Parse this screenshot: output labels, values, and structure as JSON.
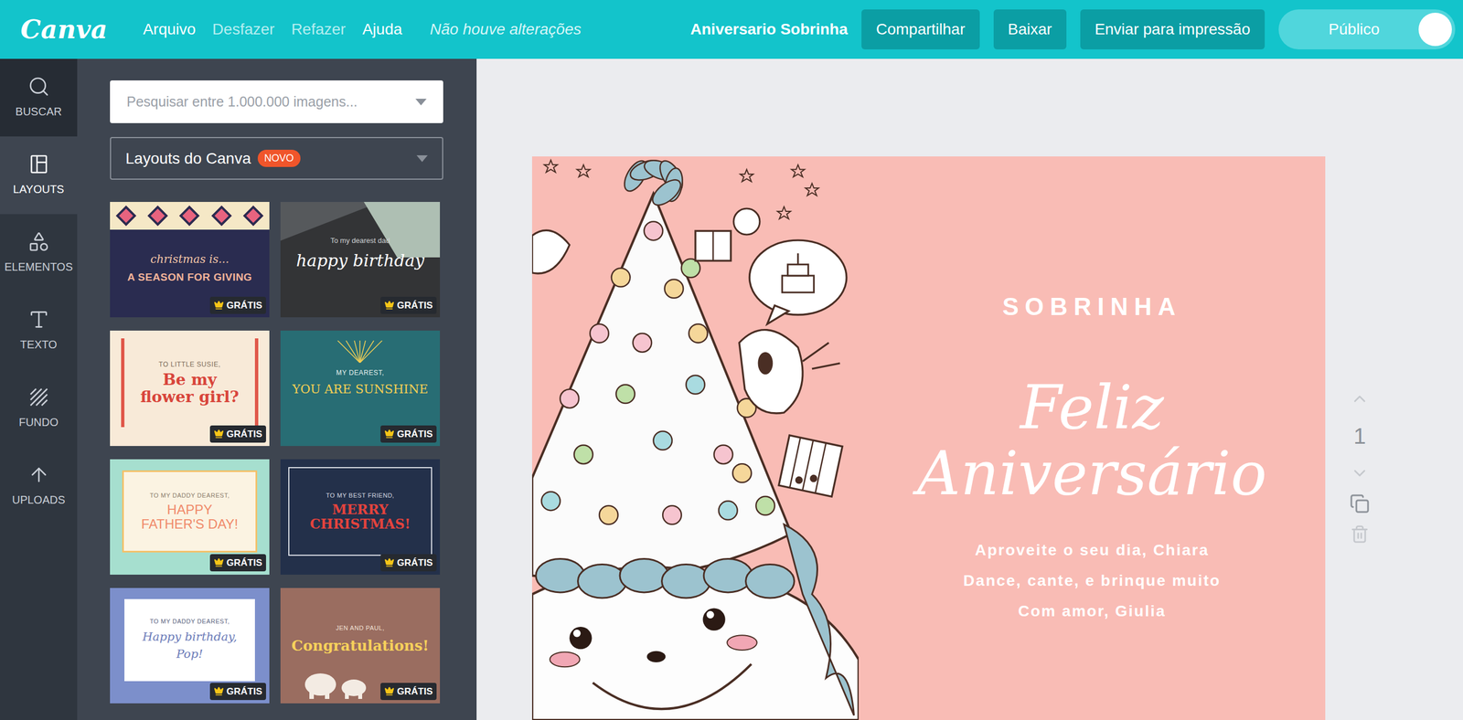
{
  "app": {
    "logo": "Canva"
  },
  "menu": [
    {
      "label": "Arquivo",
      "disabled": false
    },
    {
      "label": "Desfazer",
      "disabled": true
    },
    {
      "label": "Refazer",
      "disabled": true
    },
    {
      "label": "Ajuda",
      "disabled": false
    }
  ],
  "save_status": "Não houve alterações",
  "document_title": "Aniversario Sobrinha",
  "actions": [
    "Compartilhar",
    "Baixar",
    "Enviar para impressão"
  ],
  "visibility": {
    "label": "Público",
    "on": true
  },
  "sidebar": {
    "items": [
      {
        "label": "BUSCAR",
        "selected": false
      },
      {
        "label": "LAYOUTS",
        "selected": true
      },
      {
        "label": "ELEMENTOS",
        "selected": false
      },
      {
        "label": "TEXTO",
        "selected": false
      },
      {
        "label": "FUNDO",
        "selected": false
      },
      {
        "label": "UPLOADS",
        "selected": false
      }
    ]
  },
  "panel": {
    "search_placeholder": "Pesquisar entre 1.000.000 imagens...",
    "category": "Layouts do Canva",
    "category_badge": "NOVO",
    "layouts": [
      {
        "kicker": "christmas is...",
        "title": "A SEASON FOR GIVING",
        "badge": "GRÁTIS"
      },
      {
        "kicker": "To my dearest dad",
        "title": "happy birthday",
        "badge": "GRÁTIS"
      },
      {
        "kicker": "TO LITTLE SUSIE,",
        "title": "Be my flower girl?",
        "badge": "GRÁTIS"
      },
      {
        "kicker": "MY DEAREST,",
        "title": "YOU ARE SUNSHINE",
        "badge": "GRÁTIS"
      },
      {
        "kicker": "TO MY DADDY DEAREST,",
        "title": "HAPPY FATHER'S DAY!",
        "badge": "GRÁTIS"
      },
      {
        "kicker": "TO MY BEST FRIEND,",
        "title": "MERRY CHRISTMAS!",
        "badge": "GRÁTIS"
      },
      {
        "kicker": "TO MY DADDY DEAREST,",
        "title": "Happy birthday, Pop!",
        "badge": "GRÁTIS"
      },
      {
        "kicker": "JEN AND PAUL,",
        "title": "Congratulations!",
        "badge": "GRÁTIS"
      }
    ]
  },
  "design": {
    "heading": "SOBRINHA",
    "title": "Feliz Aniversário",
    "lines": [
      "Aproveite o seu dia, Chiara",
      "Dance, cante, e brinque muito",
      "Com amor, Giulia"
    ]
  },
  "page_number": "1"
}
